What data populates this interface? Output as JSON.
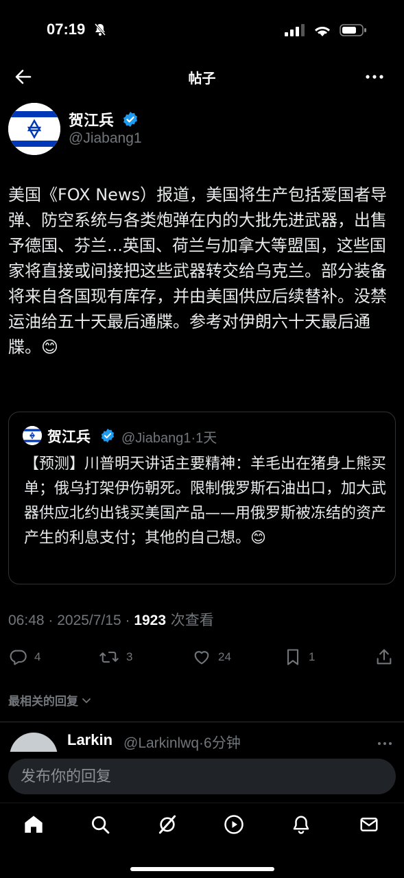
{
  "status_bar": {
    "time": "07:19",
    "icons": [
      "bell-slash-icon",
      "cellular-signal-icon",
      "wifi-icon",
      "battery-icon"
    ]
  },
  "nav": {
    "title": "帖子",
    "back_icon": "back-arrow-icon",
    "more_icon": "more-horizontal-icon"
  },
  "post": {
    "author_name": "贺江兵",
    "author_handle": "@Jiabang1",
    "avatar": "israel-flag",
    "verified": true,
    "text": "美国《FOX News）报道，美国将生产包括爱国者导弹、防空系统与各类炮弹在内的大批先进武器，出售予德国、芬兰...英国、荷兰与加拿大等盟国，这些国家将直接或间接把这些武器转交给乌克兰。部分装备将来自各国现有库存，并由美国供应后续替补。没禁运油给五十天最后通牒。参考对伊朗六十天最后通牒。😊",
    "timestamp": "06:48 · 2025/7/15 · ",
    "views": "1923",
    "views_label": " 次查看"
  },
  "quote": {
    "author_name": "贺江兵",
    "meta": "@Jiabang1·1天",
    "text": "【预测】川普明天讲话主要精神：羊毛出在猪身上熊买单；俄乌打架伊伤朝死。限制俄罗斯石油出口，加大武器供应北约出钱买美国产品——用俄罗斯被冻结的资产产生的利息支付；其他的自己想。😊"
  },
  "actions": {
    "replies": "4",
    "reposts": "3",
    "likes": "24",
    "bookmarks": "1"
  },
  "replies_sort": {
    "label": "最相关的回复"
  },
  "reply_preview": {
    "name": "Larkin",
    "meta": "@Larkinlwq·6分钟"
  },
  "compose": {
    "placeholder": "发布你的回复"
  },
  "tabbar": {
    "items": [
      "home-icon",
      "search-icon",
      "grok-icon",
      "video-icon",
      "notifications-icon",
      "messages-icon"
    ]
  },
  "colors": {
    "background": "#000000",
    "text_primary": "#e7e9ea",
    "text_secondary": "#71767b",
    "verified_blue": "#1d9bf0",
    "border": "#2f3336"
  }
}
